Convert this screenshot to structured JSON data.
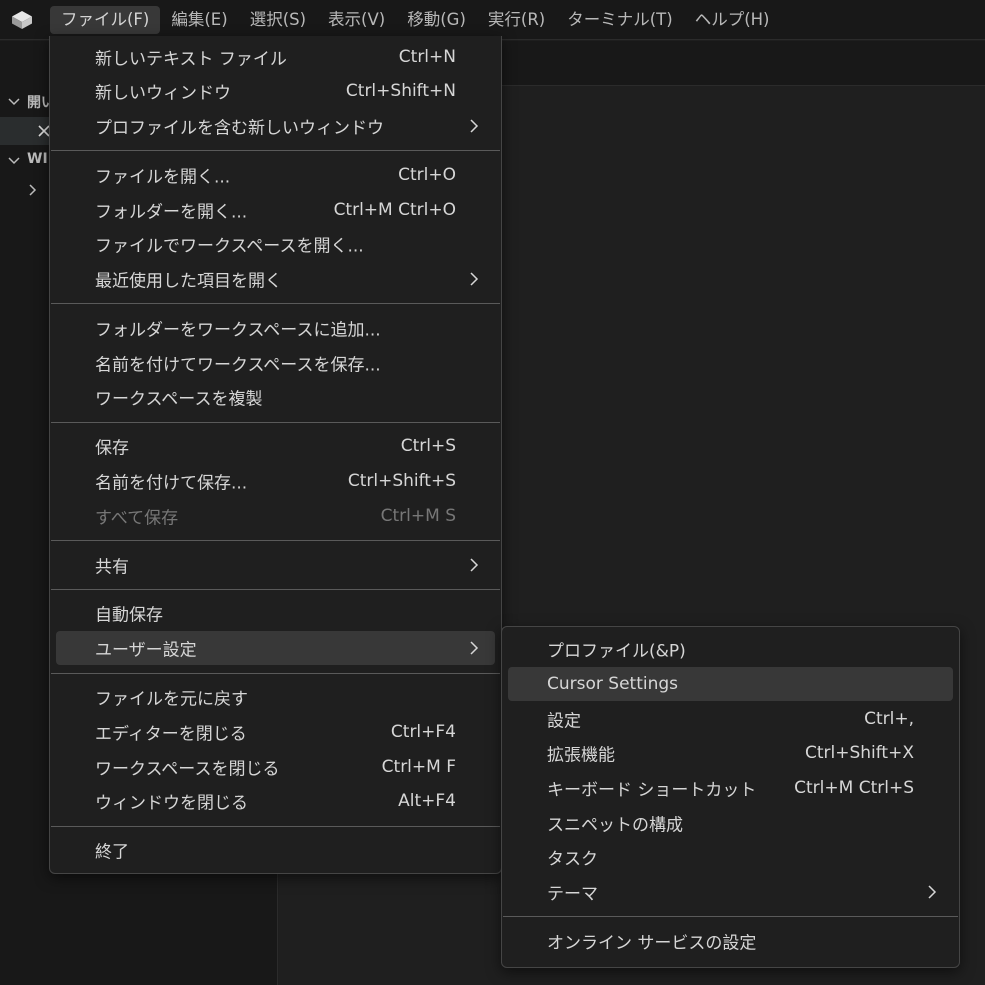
{
  "menubar": {
    "items": [
      "ファイル(F)",
      "編集(E)",
      "選択(S)",
      "表示(V)",
      "移動(G)",
      "実行(R)",
      "ターミナル(T)",
      "ヘルプ(H)"
    ]
  },
  "sidebar": {
    "section1_label": "開い",
    "section2_label": "WI"
  },
  "file_menu": {
    "new_text_file": {
      "label": "新しいテキスト ファイル",
      "shortcut": "Ctrl+N"
    },
    "new_window": {
      "label": "新しいウィンドウ",
      "shortcut": "Ctrl+Shift+N"
    },
    "new_window_profile": {
      "label": "プロファイルを含む新しいウィンドウ"
    },
    "open_file": {
      "label": "ファイルを開く...",
      "shortcut": "Ctrl+O"
    },
    "open_folder": {
      "label": "フォルダーを開く...",
      "shortcut": "Ctrl+M Ctrl+O"
    },
    "open_workspace": {
      "label": "ファイルでワークスペースを開く..."
    },
    "open_recent": {
      "label": "最近使用した項目を開く"
    },
    "add_folder_workspace": {
      "label": "フォルダーをワークスペースに追加..."
    },
    "save_workspace_as": {
      "label": "名前を付けてワークスペースを保存..."
    },
    "duplicate_workspace": {
      "label": "ワークスペースを複製"
    },
    "save": {
      "label": "保存",
      "shortcut": "Ctrl+S"
    },
    "save_as": {
      "label": "名前を付けて保存...",
      "shortcut": "Ctrl+Shift+S"
    },
    "save_all": {
      "label": "すべて保存",
      "shortcut": "Ctrl+M S"
    },
    "share": {
      "label": "共有"
    },
    "auto_save": {
      "label": "自動保存"
    },
    "preferences": {
      "label": "ユーザー設定"
    },
    "revert_file": {
      "label": "ファイルを元に戻す"
    },
    "close_editor": {
      "label": "エディターを閉じる",
      "shortcut": "Ctrl+F4"
    },
    "close_workspace": {
      "label": "ワークスペースを閉じる",
      "shortcut": "Ctrl+M F"
    },
    "close_window": {
      "label": "ウィンドウを閉じる",
      "shortcut": "Alt+F4"
    },
    "exit": {
      "label": "終了"
    }
  },
  "preferences_menu": {
    "profiles": {
      "label": "プロファイル(&P)"
    },
    "cursor_settings": {
      "label": "Cursor Settings"
    },
    "settings": {
      "label": "設定",
      "shortcut": "Ctrl+,"
    },
    "extensions": {
      "label": "拡張機能",
      "shortcut": "Ctrl+Shift+X"
    },
    "keyboard_shortcuts": {
      "label": "キーボード ショートカット",
      "shortcut": "Ctrl+M Ctrl+S"
    },
    "snippets": {
      "label": "スニペットの構成"
    },
    "tasks": {
      "label": "タスク"
    },
    "theme": {
      "label": "テーマ"
    },
    "online_services": {
      "label": "オンライン サービスの設定"
    }
  },
  "colors": {
    "background": "#1e1e1e",
    "menu_background": "#1f1f1f",
    "highlight": "#383838",
    "text": "#d6d6d6",
    "disabled_text": "#777777"
  }
}
